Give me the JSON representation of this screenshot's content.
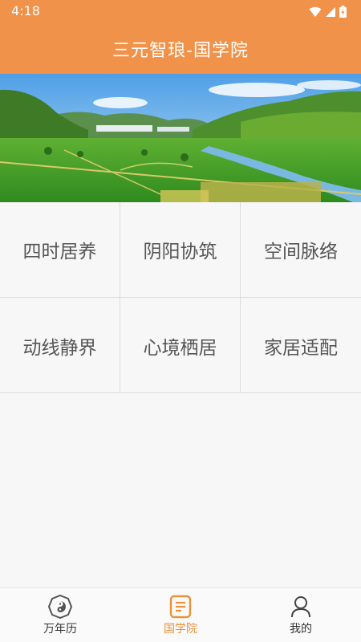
{
  "status_bar": {
    "time": "4:18"
  },
  "app_bar": {
    "title": "三元智琅-国学院"
  },
  "banner": {
    "image": "landscape-photo-rice-fields-mountains",
    "active_index": 0,
    "dot_count": 2
  },
  "menu": [
    {
      "label": "四时居养"
    },
    {
      "label": "阴阳协筑"
    },
    {
      "label": "空间脉络"
    },
    {
      "label": "动线静界"
    },
    {
      "label": "心境栖居"
    },
    {
      "label": "家居适配"
    }
  ],
  "tabs": [
    {
      "label": "万年历",
      "icon": "bagua-icon"
    },
    {
      "label": "国学院",
      "icon": "book-icon",
      "active": true
    },
    {
      "label": "我的",
      "icon": "person-icon"
    }
  ],
  "colors": {
    "accent": "#f0924a",
    "active_tab": "#e8923a"
  }
}
